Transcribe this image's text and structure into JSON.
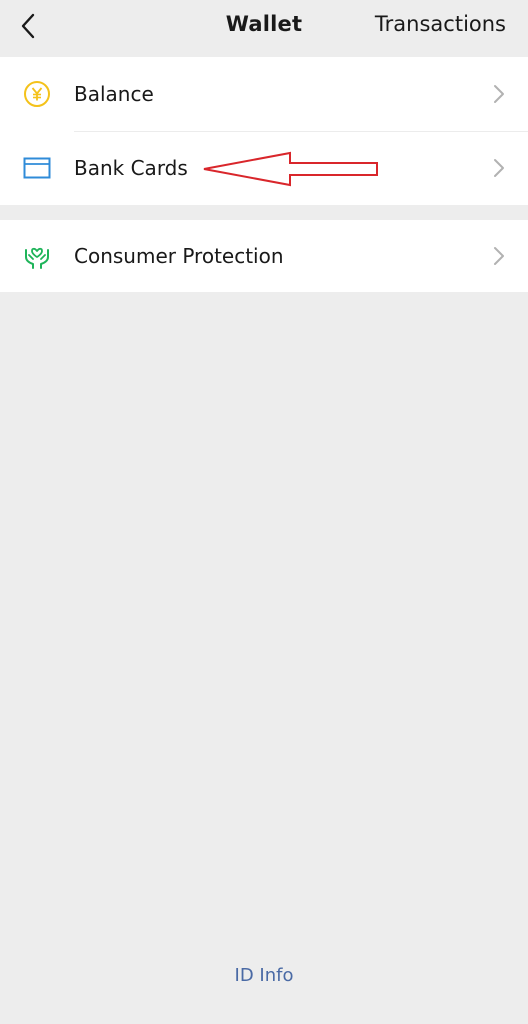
{
  "header": {
    "back_icon": "chevron-left-icon",
    "title": "Wallet",
    "right_action": "Transactions"
  },
  "menu": {
    "groups": [
      {
        "items": [
          {
            "label": "Balance",
            "icon": "yen-coin-icon",
            "icon_color": "#f4c21a"
          },
          {
            "label": "Bank Cards",
            "icon": "bank-card-icon",
            "icon_color": "#2f8bd8"
          }
        ]
      },
      {
        "items": [
          {
            "label": "Consumer Protection",
            "icon": "protection-hands-icon",
            "icon_color": "#1fb45a"
          }
        ]
      }
    ]
  },
  "annotation": {
    "type": "arrow",
    "color": "#d9262b",
    "points_to": "Bank Cards"
  },
  "footer": {
    "link": "ID Info",
    "link_color": "#4a6aa5"
  },
  "colors": {
    "background": "#ededed",
    "card": "#ffffff",
    "chevron": "#b2b2b2"
  }
}
